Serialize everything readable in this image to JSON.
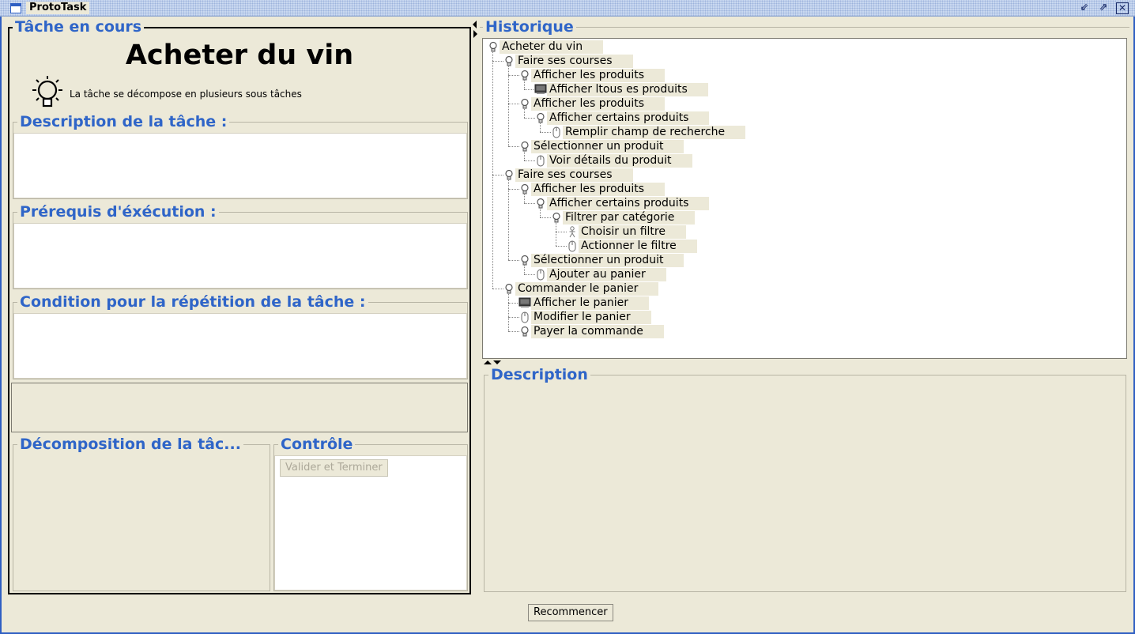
{
  "window": {
    "title": "ProtoTask"
  },
  "current_task": {
    "legend": "Tâche en cours",
    "title": "Acheter du vin",
    "info": "La tâche se décompose en plusieurs sous tâches",
    "description_label": "Description de la tâche :",
    "prerequisites_label": "Prérequis d'éxécution :",
    "repeat_label": "Condition pour la répétition de la tâche :",
    "decomposition_label": "Décomposition de la tâc...",
    "control_label": "Contrôle",
    "validate_button": "Valider et Terminer"
  },
  "history": {
    "legend": "Historique",
    "tree": [
      {
        "label": "Acheter du vin",
        "icon": "bulb-icon",
        "level": 0
      },
      {
        "label": "Faire ses courses",
        "icon": "bulb-icon",
        "level": 1
      },
      {
        "label": "Afficher les produits",
        "icon": "bulb-icon",
        "level": 2
      },
      {
        "label": "Afficher ltous es produits",
        "icon": "monitor-icon",
        "level": 3
      },
      {
        "label": "Afficher les produits",
        "icon": "bulb-icon",
        "level": 2
      },
      {
        "label": "Afficher certains produits",
        "icon": "bulb-icon",
        "level": 3
      },
      {
        "label": "Remplir champ de recherche",
        "icon": "mouse-icon",
        "level": 4
      },
      {
        "label": "Sélectionner un produit",
        "icon": "bulb-icon",
        "level": 2
      },
      {
        "label": "Voir détails du produit",
        "icon": "mouse-icon",
        "level": 3
      },
      {
        "label": "Faire ses courses",
        "icon": "bulb-icon",
        "level": 1
      },
      {
        "label": "Afficher les produits",
        "icon": "bulb-icon",
        "level": 2
      },
      {
        "label": "Afficher certains produits",
        "icon": "bulb-icon",
        "level": 3
      },
      {
        "label": "Filtrer par catégorie",
        "icon": "bulb-icon",
        "level": 4
      },
      {
        "label": "Choisir un filtre",
        "icon": "person-icon",
        "level": 5
      },
      {
        "label": "Actionner le filtre",
        "icon": "mouse-icon",
        "level": 5
      },
      {
        "label": "Sélectionner un produit",
        "icon": "bulb-icon",
        "level": 2
      },
      {
        "label": "Ajouter au panier",
        "icon": "mouse-icon",
        "level": 3
      },
      {
        "label": "Commander le panier",
        "icon": "bulb-icon",
        "level": 1
      },
      {
        "label": "Afficher le panier",
        "icon": "monitor-icon",
        "level": 2
      },
      {
        "label": "Modifier le panier",
        "icon": "mouse-icon",
        "level": 2
      },
      {
        "label": "Payer la commande",
        "icon": "bulb-icon",
        "level": 2
      }
    ]
  },
  "description": {
    "legend": "Description"
  },
  "footer": {
    "restart_button": "Recommencer"
  },
  "colors": {
    "accent": "#2F65C8",
    "background": "#ECE9D8",
    "border": "#2F5FC3"
  }
}
